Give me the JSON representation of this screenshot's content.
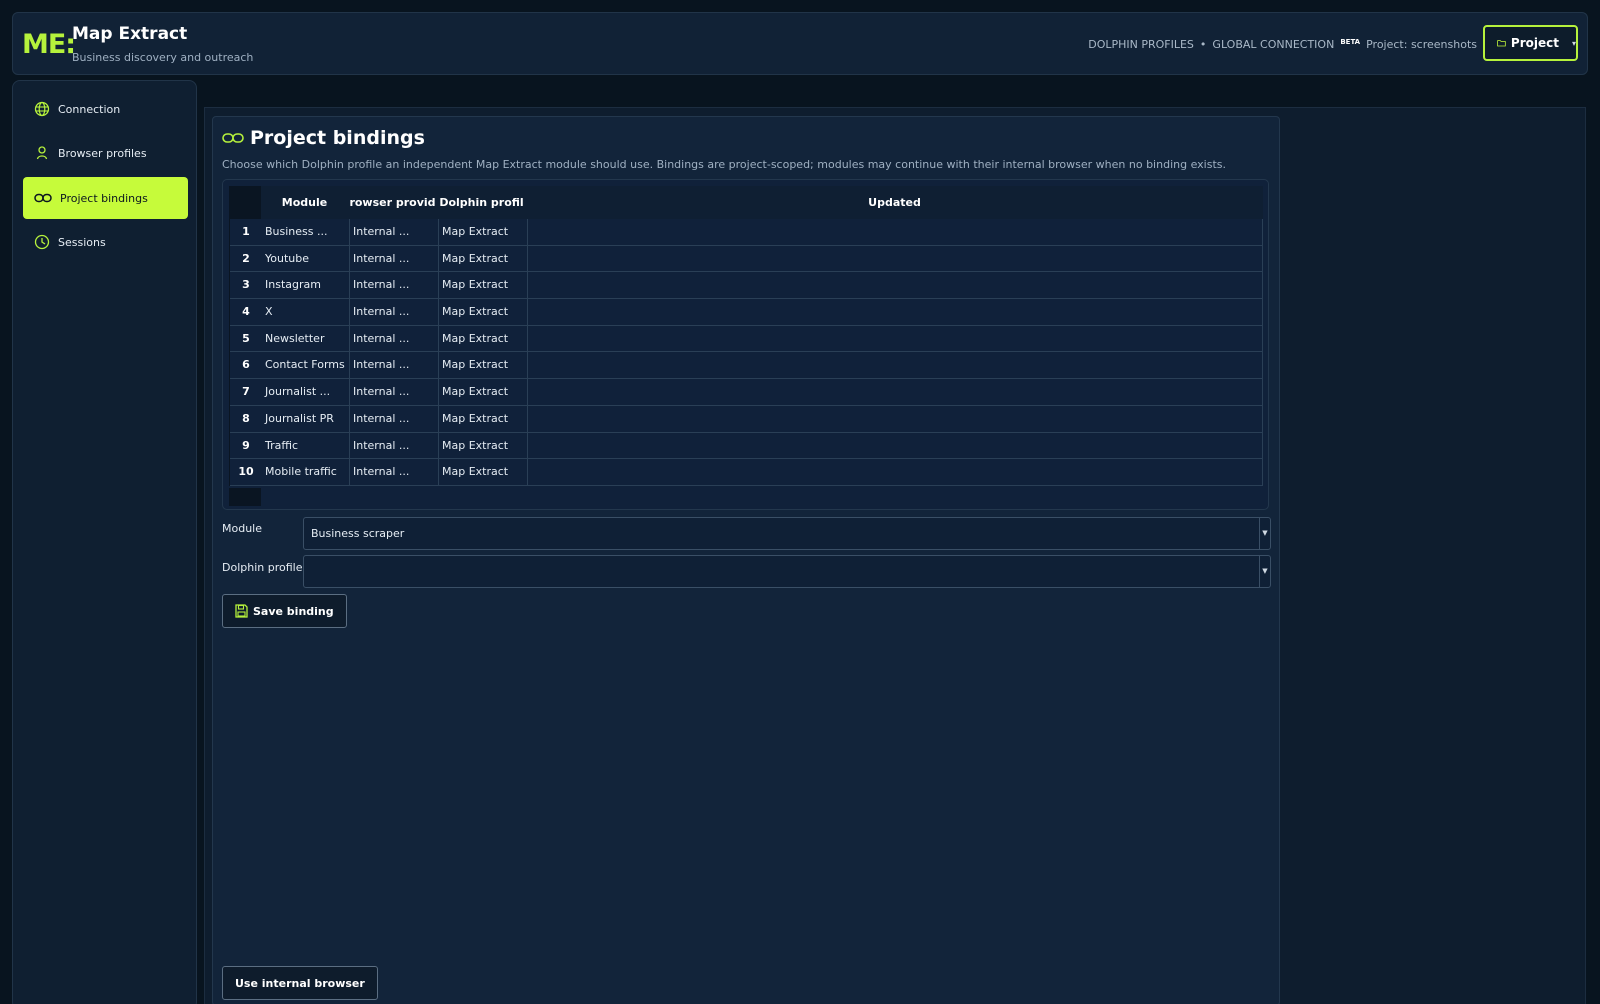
{
  "header": {
    "logo": "ME:",
    "title": "Map Extract",
    "subtitle": "Business discovery and outreach",
    "nav_dolphin": "DOLPHIN PROFILES",
    "separator": "•",
    "nav_global": "GLOBAL CONNECTION",
    "beta": "BETA",
    "project_text": "Project: screenshots",
    "project_button": "Project"
  },
  "sidebar": {
    "items": [
      {
        "label": "Connection",
        "icon": "globe-icon",
        "active": false
      },
      {
        "label": "Browser profiles",
        "icon": "user-icon",
        "active": false
      },
      {
        "label": "Project bindings",
        "icon": "link-icon",
        "active": true
      },
      {
        "label": "Sessions",
        "icon": "clock-icon",
        "active": false
      }
    ]
  },
  "panel": {
    "title": "Project bindings",
    "description": "Choose which Dolphin profile an independent Map Extract module should use. Bindings are project-scoped; modules may continue with their internal browser when no binding exists."
  },
  "table": {
    "columns": [
      "Module",
      "rowser provid",
      "Dolphin profil",
      "Updated"
    ],
    "rows": [
      {
        "n": "1",
        "module": "Business ...",
        "provider": "Internal ...",
        "profile": "Map Extract",
        "updated": ""
      },
      {
        "n": "2",
        "module": "Youtube",
        "provider": "Internal ...",
        "profile": "Map Extract",
        "updated": ""
      },
      {
        "n": "3",
        "module": "Instagram",
        "provider": "Internal ...",
        "profile": "Map Extract",
        "updated": ""
      },
      {
        "n": "4",
        "module": "X",
        "provider": "Internal ...",
        "profile": "Map Extract",
        "updated": ""
      },
      {
        "n": "5",
        "module": "Newsletter",
        "provider": "Internal ...",
        "profile": "Map Extract",
        "updated": ""
      },
      {
        "n": "6",
        "module": "Contact Forms",
        "provider": "Internal ...",
        "profile": "Map Extract",
        "updated": ""
      },
      {
        "n": "7",
        "module": "Journalist ...",
        "provider": "Internal ...",
        "profile": "Map Extract",
        "updated": ""
      },
      {
        "n": "8",
        "module": "Journalist PR",
        "provider": "Internal ...",
        "profile": "Map Extract",
        "updated": ""
      },
      {
        "n": "9",
        "module": "Traffic",
        "provider": "Internal ...",
        "profile": "Map Extract",
        "updated": ""
      },
      {
        "n": "10",
        "module": "Mobile traffic",
        "provider": "Internal ...",
        "profile": "Map Extract",
        "updated": ""
      }
    ]
  },
  "form": {
    "module_label": "Module",
    "module_value": "Business scraper",
    "profile_label": "Dolphin profile",
    "profile_value": "",
    "save_button": "Save binding",
    "internal_button": "Use internal browser"
  },
  "colors": {
    "accent": "#c6fb3a",
    "background": "#08141f",
    "panel": "#12243a"
  }
}
